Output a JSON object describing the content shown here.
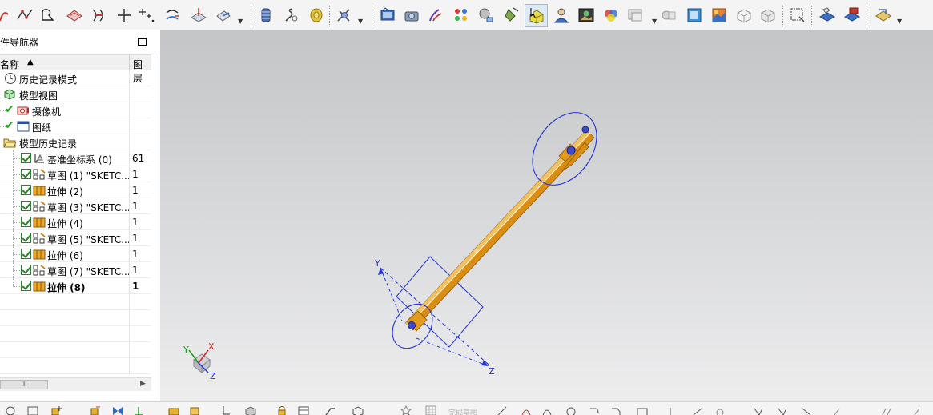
{
  "toolbar": {
    "icons": [
      "curve-icon",
      "spline-icon",
      "circle-icon",
      "surface-icon",
      "intersection-curve-icon",
      "plus-icon",
      "point-set-icon",
      "offset-curve-icon",
      "datum-plane-icon",
      "datum-csys-icon",
      "spring-icon",
      "coil-icon",
      "tape-icon",
      "cable-icon",
      "render-icon",
      "camera-view-icon",
      "paint-icon",
      "materials-icon",
      "shading-icon",
      "light-icon",
      "select-body-icon",
      "user-icon",
      "image-icon",
      "palette-icon",
      "display-icon",
      "face-icon",
      "cube-icon",
      "texture-icon",
      "wireframe-icon",
      "box-icon",
      "frame-icon",
      "layer-icon",
      "move-layer-icon",
      "sketch-icon"
    ]
  },
  "navigator": {
    "title": "件导航器",
    "col_name": "名称",
    "col_layer": "图层",
    "sort_indicator": "▲",
    "items": [
      {
        "label": "历史记录模式",
        "layer": "",
        "icon": "clock-icon",
        "level": 0
      },
      {
        "label": "模型视图",
        "layer": "",
        "icon": "model-view-icon",
        "level": 0
      },
      {
        "label": "摄像机",
        "layer": "",
        "icon": "camera-icon",
        "level": 0
      },
      {
        "label": "图纸",
        "layer": "",
        "icon": "drawing-icon",
        "level": 0
      },
      {
        "label": "模型历史记录",
        "layer": "",
        "icon": "folder-icon",
        "level": 0
      },
      {
        "label": "基准坐标系 (0)",
        "layer": "61",
        "icon": "datum-csys-icon",
        "level": 1
      },
      {
        "label": "草图 (1) \"SKETC...",
        "layer": "1",
        "icon": "sketch-icon",
        "level": 1
      },
      {
        "label": "拉伸 (2)",
        "layer": "1",
        "icon": "extrude-icon",
        "level": 1
      },
      {
        "label": "草图 (3) \"SKETC...",
        "layer": "1",
        "icon": "sketch-icon",
        "level": 1
      },
      {
        "label": "拉伸 (4)",
        "layer": "1",
        "icon": "extrude-icon",
        "level": 1
      },
      {
        "label": "草图 (5) \"SKETC...",
        "layer": "1",
        "icon": "sketch-icon",
        "level": 1
      },
      {
        "label": "拉伸 (6)",
        "layer": "1",
        "icon": "extrude-icon",
        "level": 1
      },
      {
        "label": "草图 (7) \"SKETC...",
        "layer": "1",
        "icon": "sketch-icon",
        "level": 1
      },
      {
        "label": "拉伸 (8)",
        "layer": "1",
        "icon": "extrude-icon",
        "level": 1,
        "bold": true
      }
    ],
    "scroll_thumb_label": "III",
    "scroll_right_arrow": "▶"
  },
  "viewport": {
    "axis_labels": {
      "x": "X",
      "y": "Y",
      "z": "Z"
    },
    "triad_labels": {
      "x": "X",
      "y": "Y",
      "z": "Z"
    },
    "part_color": "#d98d12",
    "handle_color": "#1f2ee0"
  },
  "bottombar": {
    "sketch_label": "完成草图"
  }
}
